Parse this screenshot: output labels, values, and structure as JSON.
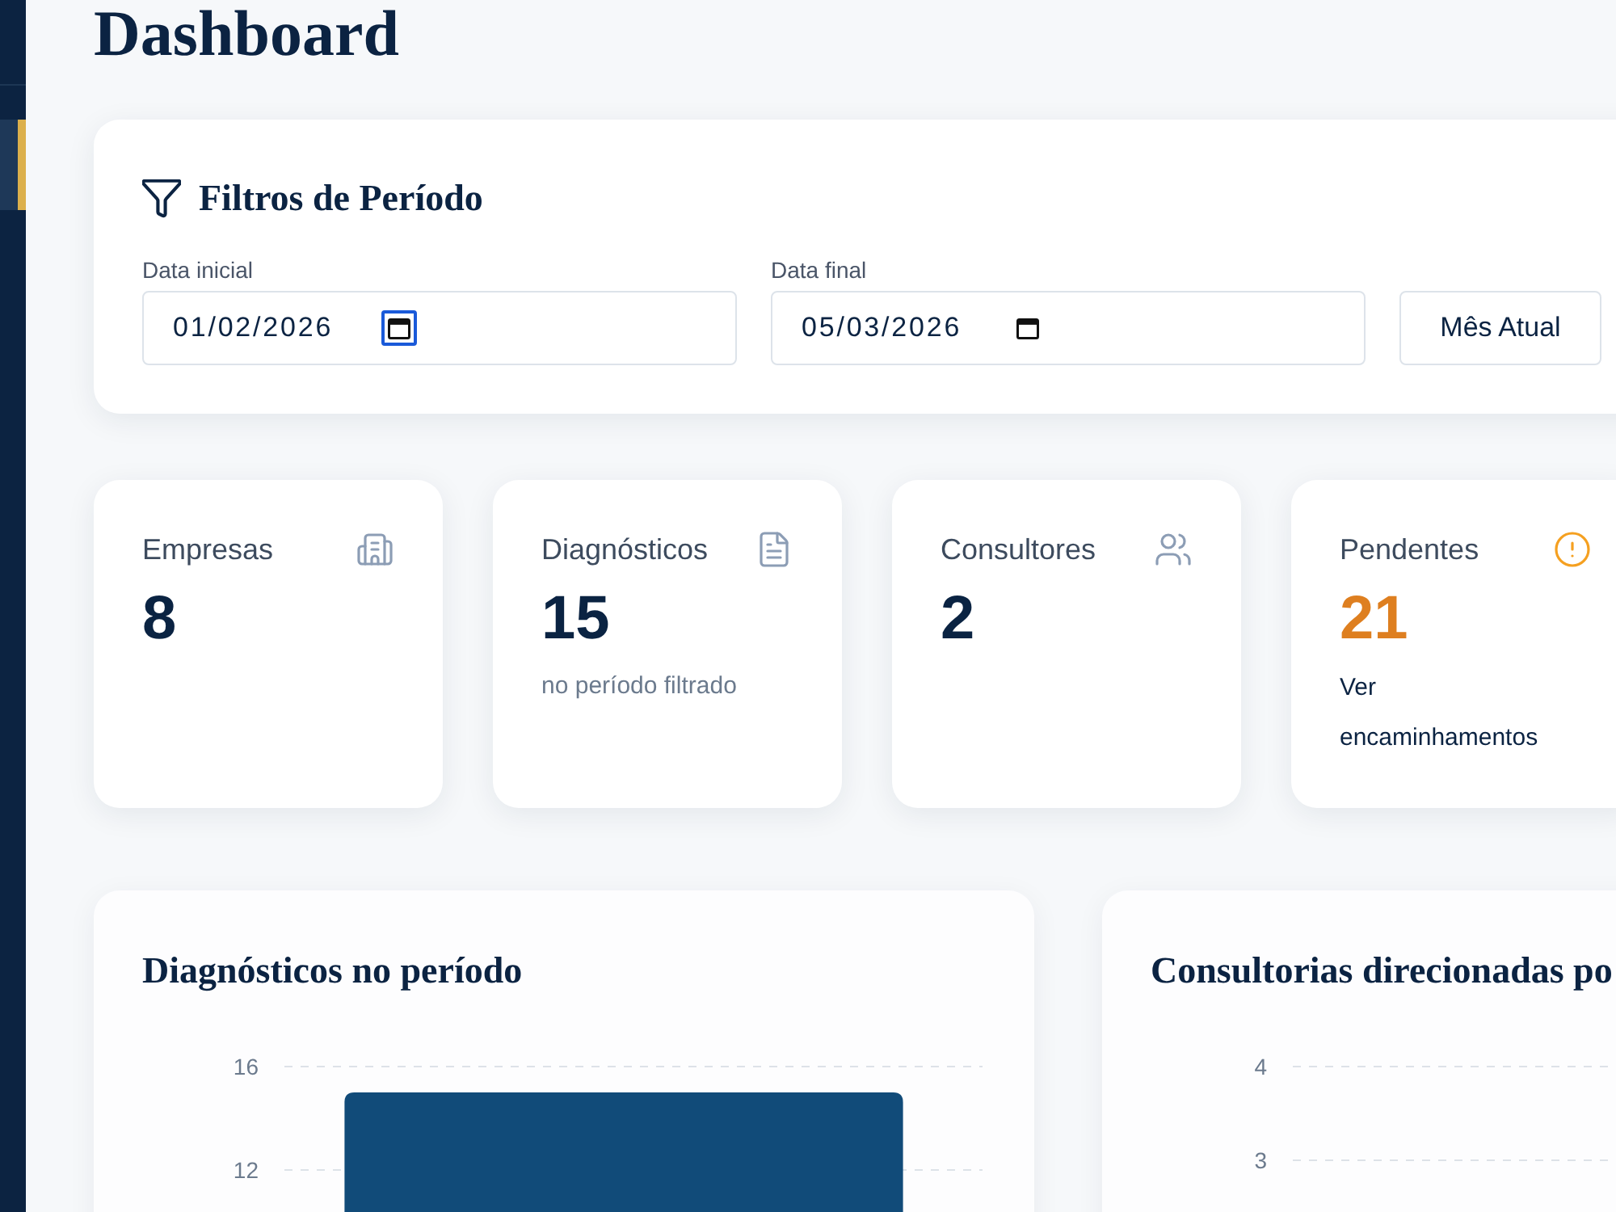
{
  "sidebar": {
    "items": [
      {
        "selected": true
      }
    ]
  },
  "page": {
    "title": "Dashboard"
  },
  "filters": {
    "title": "Filtros de Período",
    "fields": [
      {
        "label": "Data inicial",
        "value": "01/02/2026",
        "picker_focused": true
      },
      {
        "label": "Data final",
        "value": "05/03/2026",
        "picker_focused": false
      }
    ],
    "button": "Mês Atual"
  },
  "stats": [
    {
      "label": "Empresas",
      "value": "8",
      "kind": "count"
    },
    {
      "label": "Diagnósticos",
      "value": "15",
      "note": "no período filtrado",
      "kind": "count"
    },
    {
      "label": "Consultores",
      "value": "2",
      "kind": "count"
    },
    {
      "label": "Pendentes",
      "value": "21",
      "link": "Ver encaminhamentos",
      "kind": "warning"
    }
  ],
  "charts": [
    {
      "title": "Diagnósticos no período",
      "chart_data": {
        "type": "bar",
        "categories": [
          null
        ],
        "values": [
          15
        ],
        "yticks": [
          12,
          16
        ],
        "ylim": [
          10,
          16
        ]
      }
    },
    {
      "title": "Consultorias direcionadas po",
      "axis_labels": [
        "4",
        "3"
      ]
    }
  ]
}
